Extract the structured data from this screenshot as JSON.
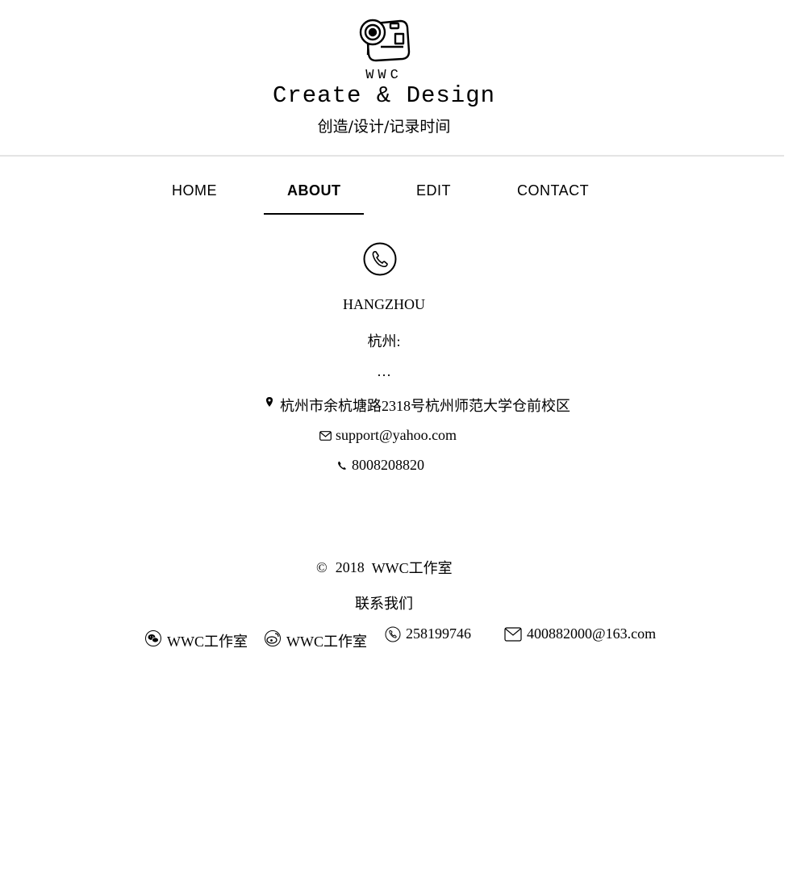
{
  "header": {
    "brand": "WWC",
    "tagline": "Create & Design",
    "subtitle": "创造/设计/记录时间"
  },
  "nav": {
    "items": [
      {
        "label": "HOME",
        "active": false
      },
      {
        "label": "ABOUT",
        "active": true
      },
      {
        "label": "EDIT",
        "active": false
      },
      {
        "label": "CONTACT",
        "active": false
      }
    ]
  },
  "contact": {
    "city_en": "HANGZHOU",
    "city_cn": "杭州:",
    "ellipsis": "…",
    "address": "杭州市余杭塘路2318号杭州师范大学仓前校区",
    "email": "support@yahoo.com",
    "phone": "8008208820"
  },
  "footer": {
    "copyright_symbol": "©",
    "year": "2018",
    "studio": "WWC工作室",
    "contact_us": "联系我们",
    "wechat": "WWC工作室",
    "weibo": "WWC工作室",
    "qq_phone": "258199746",
    "email": "400882000@163.com"
  },
  "icons": {
    "logo": "camera-icon",
    "phone_circle": "phone-circle-icon",
    "location": "location-pin-icon",
    "email": "envelope-icon",
    "phone": "phone-icon",
    "wechat": "wechat-icon",
    "weibo": "weibo-icon"
  }
}
